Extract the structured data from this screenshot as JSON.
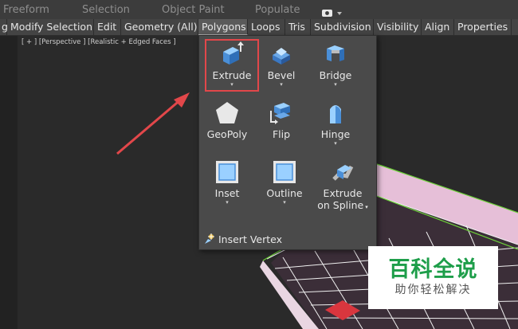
{
  "menubar": {
    "items": [
      "Freeform",
      "Selection",
      "Object Paint",
      "Populate"
    ]
  },
  "tabs": [
    {
      "label": "g"
    },
    {
      "label": "Modify Selection"
    },
    {
      "label": "Edit"
    },
    {
      "label": "Geometry (All)"
    },
    {
      "label": "Polygons",
      "active": true
    },
    {
      "label": "Loops"
    },
    {
      "label": "Tris"
    },
    {
      "label": "Subdivision"
    },
    {
      "label": "Visibility"
    },
    {
      "label": "Align"
    },
    {
      "label": "Properties"
    }
  ],
  "viewport": {
    "label": "[ + ] [Perspective ] [Realistic + Edged Faces ]"
  },
  "polygons_panel": {
    "tools": [
      {
        "label": "Extrude",
        "has_dropdown": true,
        "icon": "extrude-icon"
      },
      {
        "label": "Bevel",
        "has_dropdown": true,
        "icon": "bevel-icon"
      },
      {
        "label": "Bridge",
        "has_dropdown": true,
        "icon": "bridge-icon"
      },
      {
        "label": "GeoPoly",
        "has_dropdown": false,
        "icon": "geopoly-icon"
      },
      {
        "label": "Flip",
        "has_dropdown": false,
        "icon": "flip-icon"
      },
      {
        "label": "Hinge",
        "has_dropdown": true,
        "icon": "hinge-icon"
      },
      {
        "label": "Inset",
        "has_dropdown": true,
        "icon": "inset-icon"
      },
      {
        "label": "Outline",
        "has_dropdown": true,
        "icon": "outline-icon"
      },
      {
        "label": "Extrude on Spline",
        "label_line1": "Extrude",
        "label_line2": "on Spline",
        "has_dropdown": true,
        "icon": "extrude-on-spline-icon"
      }
    ],
    "insert_vertex": "Insert Vertex",
    "dropdown_glyph": "▾"
  },
  "watermark": {
    "title": "百科全说",
    "subtitle": "助你轻松解决"
  },
  "colors": {
    "highlight": "#e2474a",
    "arrow": "#e2474a",
    "pink_face": "#e6bfd8",
    "red_face": "#d9363e",
    "watermark_green": "#1e9e4a"
  }
}
